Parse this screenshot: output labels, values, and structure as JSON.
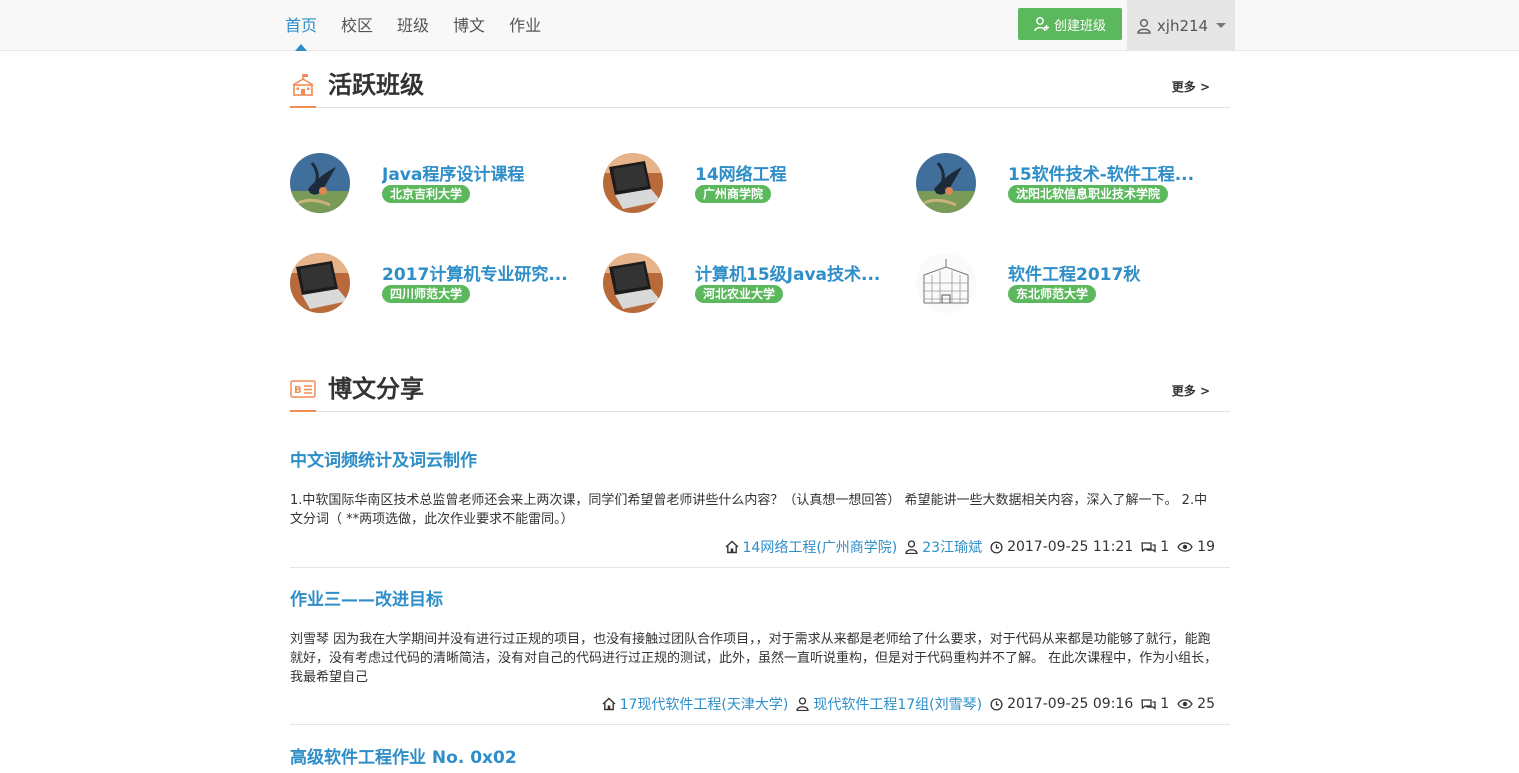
{
  "nav": {
    "links": [
      "首页",
      "校区",
      "班级",
      "博文",
      "作业"
    ],
    "create_label": "创建班级",
    "username": "xjh214"
  },
  "colors": {
    "accent": "#2e8ec8",
    "green": "#5cb85c",
    "orange": "#f28b54"
  },
  "active_classes": {
    "title": "活跃班级",
    "more": "更多 >",
    "items": [
      {
        "name": "Java程序设计课程",
        "school": "北京吉利大学",
        "avatar": "swallow-bird"
      },
      {
        "name": "14网络工程",
        "school": "广州商学院",
        "avatar": "laptop"
      },
      {
        "name": "15软件技术-软件工程...",
        "school": "沈阳北软信息职业技术学院",
        "avatar": "swallow-bird"
      },
      {
        "name": "2017计算机专业研究...",
        "school": "四川师范大学",
        "avatar": "laptop"
      },
      {
        "name": "计算机15级Java技术...",
        "school": "河北农业大学",
        "avatar": "laptop"
      },
      {
        "name": "软件工程2017秋",
        "school": "东北师范大学",
        "avatar": "building-sketch"
      }
    ]
  },
  "blog": {
    "title": "博文分享",
    "more": "更多 >",
    "posts": [
      {
        "title": "中文词频统计及词云制作",
        "summary": "1.中软国际华南区技术总监曾老师还会来上两次课，同学们希望曾老师讲些什么内容？（认真想一想回答） 希望能讲一些大数据相关内容，深入了解一下。 2.中文分词（ **两项选做，此次作业要求不能雷同。）",
        "class": "14网络工程(广州商学院)",
        "author": "23江瑜斌",
        "time": "2017-09-25 11:21",
        "comments": "1",
        "views": "19"
      },
      {
        "title": "作业三——改进目标",
        "summary": "刘雪琴 因为我在大学期间并没有进行过正规的项目，也没有接触过团队合作项目，，对于需求从来都是老师给了什么要求，对于代码从来都是功能够了就行，能跑就好，没有考虑过代码的清晰简洁，没有对自己的代码进行过正规的测试，此外，虽然一直听说重构，但是对于代码重构并不了解。 在此次课程中，作为小组长，我最希望自己",
        "class": "17现代软件工程(天津大学)",
        "author": "现代软件工程17组(刘雪琴)",
        "time": "2017-09-25 09:16",
        "comments": "1",
        "views": "25"
      },
      {
        "title": "高级软件工程作业 No. 0x02"
      }
    ]
  }
}
